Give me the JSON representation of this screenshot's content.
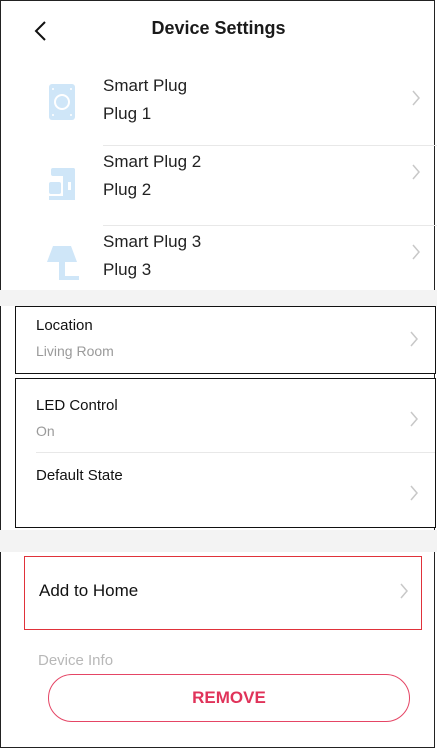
{
  "header": {
    "title": "Device Settings"
  },
  "devices": [
    {
      "name": "Smart Plug",
      "subtitle": "Plug 1",
      "icon": "plug-icon"
    },
    {
      "name": "Smart Plug 2",
      "subtitle": "Plug 2",
      "icon": "coffee-maker-icon"
    },
    {
      "name": "Smart Plug 3",
      "subtitle": "Plug 3",
      "icon": "lamp-icon"
    }
  ],
  "location": {
    "label": "Location",
    "value": "Living Room"
  },
  "led_control": {
    "label": "LED Control",
    "value": "On"
  },
  "default_state": {
    "label": "Default State"
  },
  "add_to_home": {
    "label": "Add to Home"
  },
  "device_info": {
    "label": "Device Info"
  },
  "remove_button": {
    "label": "REMOVE"
  },
  "colors": {
    "accent": "#e0335a",
    "highlight_border": "#e0323a",
    "icon_blue": "#cfe6f8"
  }
}
